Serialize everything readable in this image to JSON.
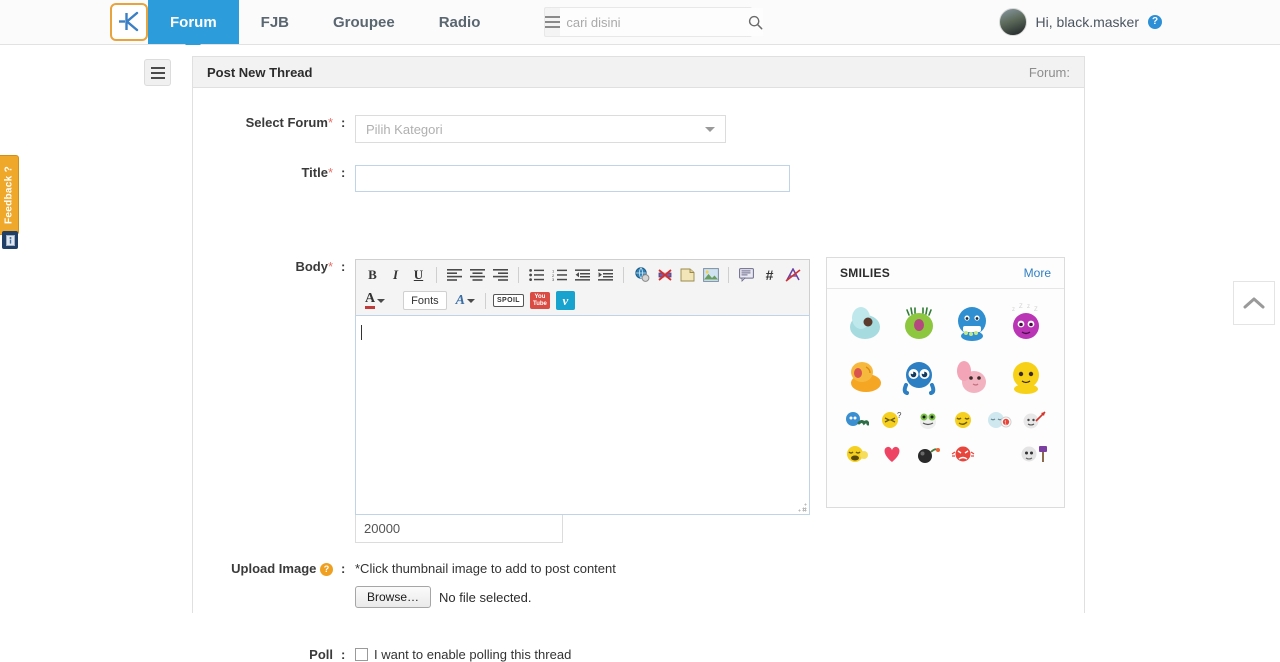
{
  "topnav": {
    "logo_alt": "Kaskus K logo",
    "items": [
      {
        "label": "Forum",
        "active": true
      },
      {
        "label": "FJB",
        "active": false
      },
      {
        "label": "Groupee",
        "active": false
      },
      {
        "label": "Radio",
        "active": false
      }
    ],
    "search": {
      "placeholder": "cari disini",
      "value": ""
    },
    "user": {
      "greeting": "Hi, black.masker",
      "help_glyph": "?"
    }
  },
  "feedback": {
    "label": "Feedback ?"
  },
  "panel": {
    "title": "Post New Thread",
    "forum_label": "Forum:"
  },
  "form": {
    "select_forum": {
      "label": "Select Forum",
      "required_mark": "*",
      "colon": ":",
      "placeholder": "Pilih Kategori",
      "value": ""
    },
    "title": {
      "label": "Title",
      "required_mark": "*",
      "colon": ":",
      "value": ""
    },
    "body": {
      "label": "Body",
      "required_mark": "*",
      "colon": ":",
      "value": "",
      "char_counter": "20000"
    },
    "upload": {
      "label": "Upload Image",
      "help_glyph": "?",
      "colon": ":",
      "note": "*Click thumbnail image to add to post content",
      "browse_label": "Browse…",
      "file_status": "No file selected."
    },
    "poll": {
      "label": "Poll",
      "colon": ":",
      "checkbox_text": "I want to enable polling this thread"
    }
  },
  "toolbar": {
    "row1": [
      {
        "name": "bold-icon",
        "glyph": "B",
        "style": "bold"
      },
      {
        "name": "italic-icon",
        "glyph": "I",
        "style": "italic"
      },
      {
        "name": "underline-icon",
        "glyph": "U",
        "style": "underline"
      },
      {
        "name": "align-left-icon",
        "glyph": "",
        "style": "lines-left"
      },
      {
        "name": "align-center-icon",
        "glyph": "",
        "style": "lines-center"
      },
      {
        "name": "align-right-icon",
        "glyph": "",
        "style": "lines-right"
      },
      {
        "name": "bullet-list-icon",
        "glyph": "",
        "style": "ul"
      },
      {
        "name": "numbered-list-icon",
        "glyph": "",
        "style": "ol"
      },
      {
        "name": "outdent-icon",
        "glyph": "",
        "style": "outdent"
      },
      {
        "name": "indent-icon",
        "glyph": "",
        "style": "indent"
      },
      {
        "name": "insert-link-icon",
        "glyph": "",
        "style": "globe"
      },
      {
        "name": "remove-link-icon",
        "glyph": "",
        "style": "unlink"
      },
      {
        "name": "insert-page-icon",
        "glyph": "",
        "style": "page"
      },
      {
        "name": "insert-image-icon",
        "glyph": "",
        "style": "image"
      },
      {
        "name": "insert-quote-icon",
        "glyph": "",
        "style": "quote"
      },
      {
        "name": "insert-code-icon",
        "glyph": "#",
        "style": "hash"
      },
      {
        "name": "clear-format-icon",
        "glyph": "",
        "style": "eraser"
      }
    ],
    "row2": {
      "text_color_label": "A",
      "fonts_label": "Fonts",
      "font_size_label": "A",
      "spoiler_label": "SPOIL",
      "youtube_label": "You Tube",
      "vimeo_label": "v"
    }
  },
  "smilies": {
    "title": "SMILIES",
    "more_label": "More",
    "big": [
      {
        "name": "smiley-shy-blue",
        "color": "#a6dbe0",
        "accent": "#5a3b2e"
      },
      {
        "name": "smiley-green-kiss",
        "color": "#8dc63f",
        "accent": "#b5497f"
      },
      {
        "name": "smiley-blue-eating",
        "color": "#2f8fd0",
        "accent": "#c3e88d"
      },
      {
        "name": "smiley-purple-dizzy",
        "color": "#b935b5",
        "accent": "#ffffff"
      },
      {
        "name": "smiley-orange-yawn",
        "color": "#f5a623",
        "accent": "#d9534f"
      },
      {
        "name": "smiley-blue-sparkle-eyes",
        "color": "#2b7fc2",
        "accent": "#ffffff"
      },
      {
        "name": "smiley-pink-shy",
        "color": "#f3b2c0",
        "accent": "#3a2a28"
      },
      {
        "name": "smiley-yellow-plain",
        "color": "#f7d117",
        "accent": "#3a2a28"
      }
    ],
    "small_row1": [
      {
        "name": "smiley-blue-worm",
        "glyph": "😵"
      },
      {
        "name": "smiley-confused-question",
        "glyph": "😕"
      },
      {
        "name": "smiley-green-frog",
        "glyph": "🐸"
      },
      {
        "name": "smiley-smirk",
        "glyph": "😏"
      },
      {
        "name": "smiley-sleep-alarm",
        "glyph": "😴"
      },
      {
        "name": "smiley-ghost-arrow",
        "glyph": "😶"
      }
    ],
    "small_row2": [
      {
        "name": "smiley-laugh-tears",
        "glyph": "😂"
      },
      {
        "name": "smiley-heart",
        "glyph": "❤"
      },
      {
        "name": "smiley-bomb",
        "glyph": "💣"
      },
      {
        "name": "smiley-angry-red",
        "glyph": "😡"
      },
      {
        "name": "smiley-blank",
        "glyph": ""
      },
      {
        "name": "smiley-ghost-hammer",
        "glyph": "🔨"
      }
    ]
  },
  "scrolltop": {
    "name": "scroll-to-top"
  },
  "colors": {
    "accent_blue": "#2d9cdb",
    "nav_text": "#5a6670",
    "feedback_orange": "#f0a82a",
    "required_red": "#e2736b",
    "panel_head_bg": "#f2f2f2",
    "input_border_focus": "#bfd4e6"
  }
}
